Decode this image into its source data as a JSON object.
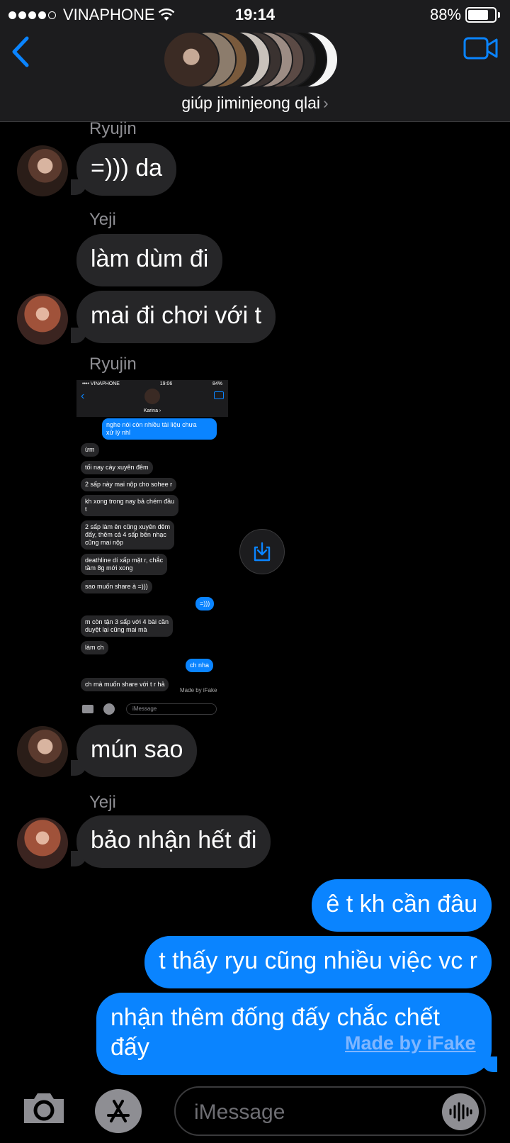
{
  "status_bar": {
    "carrier": "VINAPHONE",
    "time": "19:14",
    "battery": "88%",
    "battery_level": 0.88
  },
  "header": {
    "title": "giúp jiminjeong qlai",
    "title_chevron": "›"
  },
  "messages": [
    {
      "sender": "Ryujin",
      "text": "=))) da"
    },
    {
      "sender": "Yeji",
      "text": "làm dùm đi"
    },
    {
      "sender": "Yeji",
      "text": "mai đi chơi với t"
    },
    {
      "sender": "Ryujin",
      "text": "mún sao"
    },
    {
      "sender": "Yeji",
      "text": "bảo nhận hết đi"
    },
    {
      "sender": "me",
      "text": "ê t kh cần đâu"
    },
    {
      "sender": "me",
      "text": "t thấy ryu cũng nhiều việc vc r"
    },
    {
      "sender": "me",
      "text": "nhận thêm đống đấy chắc chết\nđấy"
    }
  ],
  "shared_screenshot": {
    "status": {
      "carrier": "•••• VINAPHONE",
      "time": "19:06",
      "battery": "84%"
    },
    "contact_name": "Karina ›",
    "bubbles": [
      {
        "dir": "out",
        "text": "nghe nói còn nhiều tài liệu chưa\nxử lý nhỉ"
      },
      {
        "dir": "in",
        "text": "ừm"
      },
      {
        "dir": "in",
        "text": "tối nay cày xuyên đêm"
      },
      {
        "dir": "in",
        "text": "2 sấp này mai nộp cho sohee r"
      },
      {
        "dir": "in",
        "text": "kh xong trong nay bả chém đầu\nt"
      },
      {
        "dir": "in",
        "text": "2 sấp làm ên cũng xuyên đêm\nđấy, thêm cả 4 sấp bên nhạc\ncũng mai nộp"
      },
      {
        "dir": "in",
        "text": "deathline dí xấp mặt r, chắc\ntầm 8g mới xong"
      },
      {
        "dir": "in",
        "text": "sao muốn share à =)))"
      },
      {
        "dir": "out",
        "text": "=)))"
      },
      {
        "dir": "in",
        "text": "m còn tận 3 sấp với 4 bài cần\nduyệt lại cũng mai mà"
      },
      {
        "dir": "in",
        "text": "làm ch"
      },
      {
        "dir": "out",
        "text": "ch nha"
      },
      {
        "dir": "in",
        "text": "ch mà muốn share với t r hả"
      }
    ],
    "input_placeholder": "iMessage",
    "watermark": "Made by iFake"
  },
  "watermark": "Made by iFake",
  "input": {
    "placeholder": "iMessage"
  },
  "colors": {
    "accent": "#0a84ff",
    "incoming": "#262628",
    "header": "#1c1c1e"
  },
  "icons": [
    "back-chevron-icon",
    "video-call-icon",
    "save-download-icon",
    "camera-icon",
    "app-store-icon",
    "audio-waveform-icon"
  ]
}
